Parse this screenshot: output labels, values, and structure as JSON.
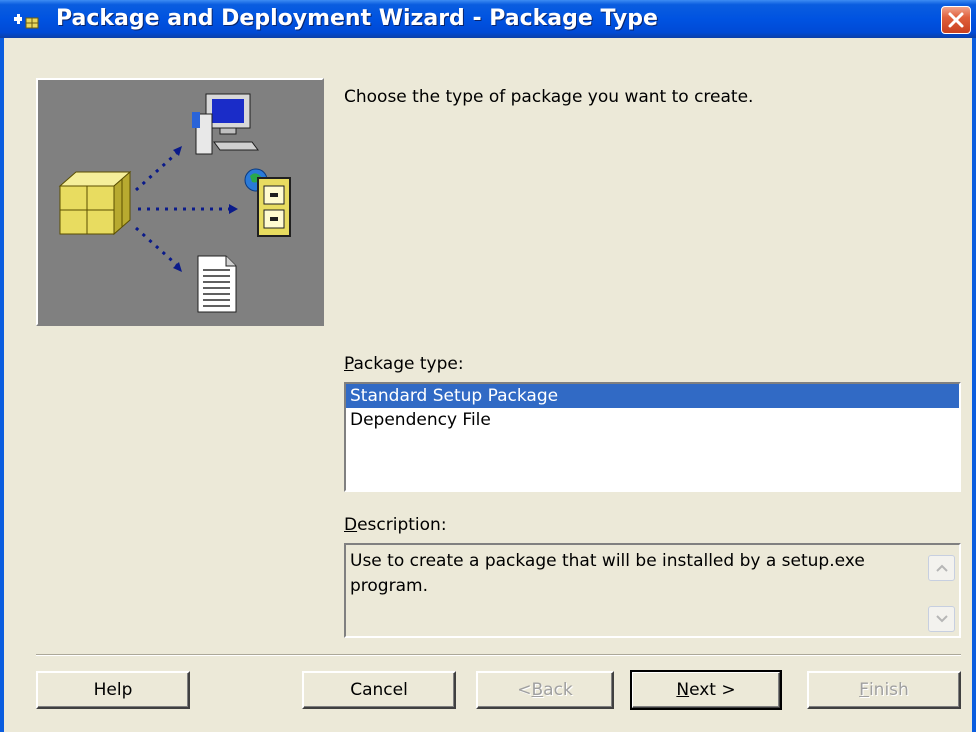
{
  "window": {
    "title": "Package and Deployment Wizard - Package Type"
  },
  "content": {
    "instruction": "Choose the type of package you want to create.",
    "package_type_label": {
      "prefix": "",
      "mnemonic": "P",
      "rest": "ackage type:"
    },
    "package_types": [
      {
        "label": "Standard Setup Package",
        "selected": true
      },
      {
        "label": "Dependency File",
        "selected": false
      }
    ],
    "description_label": {
      "prefix": "",
      "mnemonic": "D",
      "rest": "escription:"
    },
    "description_text": "Use to create a package that will be installed by a setup.exe program."
  },
  "buttons": {
    "help": "Help",
    "cancel": "Cancel",
    "back": {
      "prefix": "< ",
      "mnemonic": "B",
      "rest": "ack"
    },
    "next": {
      "prefix": "",
      "mnemonic": "N",
      "rest": "ext >"
    },
    "finish": {
      "prefix": "",
      "mnemonic": "F",
      "rest": "inish"
    }
  },
  "colors": {
    "title_bar": "#0053e1",
    "selection": "#316ac5",
    "dialog_bg": "#ece9d8",
    "close_button": "#e0603c"
  },
  "icons": [
    "wizard-app-icon",
    "close-icon",
    "package-icon",
    "computer-icon",
    "file-cabinet-icon",
    "document-icon",
    "scroll-up-icon",
    "scroll-down-icon"
  ]
}
